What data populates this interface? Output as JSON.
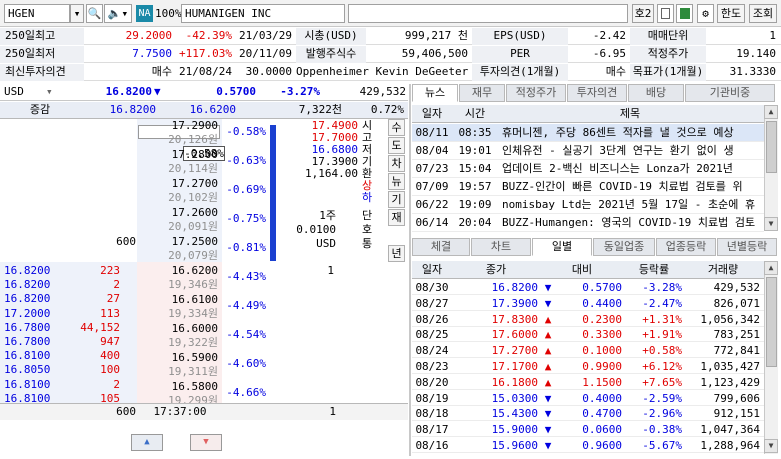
{
  "toolbar": {
    "symbol": "HGEN",
    "exchange_badge": "NA",
    "zoom": "100%",
    "company": "HUMANIGEN INC",
    "screen_no": "호2",
    "limit_label": "한도",
    "lookup_label": "조회"
  },
  "info": {
    "r1": {
      "k1": "250일최고",
      "v1": "29.2000",
      "p1": "-42.39%",
      "d1": "21/03/29",
      "k2": "시총(USD)",
      "v2": "999,217 천",
      "k3": "EPS(USD)",
      "v3": "-2.42",
      "k4": "매매단위",
      "v4": "1"
    },
    "r2": {
      "k1": "250일최저",
      "v1": "7.7500",
      "p1": "+117.03%",
      "d1": "20/11/09",
      "k2": "발행주식수",
      "v2": "59,406,500",
      "k3": "PER",
      "v3": "-6.95",
      "k4": "적정주가",
      "v4": "19.140"
    },
    "r3": {
      "k1": "최신투자의견",
      "v1": "매수",
      "d1": "21/08/24",
      "t1": "30.0000",
      "analyst": "Oppenheimer Kevin DeGeeter",
      "k3": "투자의견(1개월)",
      "v3": "매수",
      "k4": "목표가(1개월)",
      "v4": "31.3330"
    }
  },
  "quote": {
    "currency": "USD",
    "price": "16.8200",
    "change": "0.5700",
    "pct": "-3.27%",
    "volume": "429,532",
    "incr_label": "증감",
    "bid_total": "16.8200",
    "ask_total": "16.6200",
    "vol2": "7,322천",
    "ratio": "0.72%"
  },
  "orderbook": {
    "asks": [
      {
        "price": "17.2900",
        "sub": "20,126원",
        "pct": "-0.58%"
      },
      {
        "price": "17.2800",
        "sub": "20,114원",
        "pct": "-0.63%"
      },
      {
        "price": "17.2700",
        "sub": "20,102원",
        "pct": "-0.69%"
      },
      {
        "price": "17.2600",
        "sub": "20,091원",
        "pct": "-0.75%"
      },
      {
        "price": "17.2500",
        "sub": "20,079원",
        "pct": "-0.81%",
        "qty": "600"
      }
    ],
    "tooltip": "-0.58%",
    "bids": [
      {
        "price": "16.6200",
        "sub": "19,346원",
        "pct": "-4.43%",
        "qty": "1"
      },
      {
        "price": "16.6100",
        "sub": "19,334원",
        "pct": "-4.49%"
      },
      {
        "price": "16.6000",
        "sub": "19,322원",
        "pct": "-4.54%"
      },
      {
        "price": "16.5900",
        "sub": "19,311원",
        "pct": "-4.60%"
      },
      {
        "price": "16.5800",
        "sub": "19,299원",
        "pct": "-4.66%"
      }
    ],
    "ohlc": [
      {
        "v": "17.4900",
        "c": "red"
      },
      {
        "v": "17.7000",
        "c": "red"
      },
      {
        "v": "16.6800",
        "c": "blue"
      },
      {
        "v": "17.3900",
        "c": "black"
      },
      {
        "v": "1,164.00",
        "c": "black"
      }
    ],
    "ohlc_labels": [
      "시",
      "고",
      "저",
      "기",
      "환"
    ],
    "sell_label": "상",
    "buy_label": "하",
    "unit": "1주",
    "min_tick": "0.0100",
    "ccy": "USD",
    "unit_labels": [
      "단",
      "호",
      "통"
    ],
    "side_tabs": [
      "수",
      "도",
      "차",
      "뉴",
      "기",
      "재",
      "년"
    ],
    "ticks": [
      {
        "p": "16.8200",
        "q": "223"
      },
      {
        "p": "16.8200",
        "q": "2"
      },
      {
        "p": "16.8200",
        "q": "27"
      },
      {
        "p": "17.2000",
        "q": "113"
      },
      {
        "p": "16.7800",
        "q": "44,152"
      },
      {
        "p": "16.7800",
        "q": "947"
      },
      {
        "p": "16.8100",
        "q": "400"
      },
      {
        "p": "16.8050",
        "q": "100"
      },
      {
        "p": "16.8100",
        "q": "2"
      },
      {
        "p": "16.8100",
        "q": "105"
      }
    ],
    "footer": {
      "left": "600",
      "time": "17:37:00",
      "right": "1"
    }
  },
  "news": {
    "tabs": [
      "뉴스",
      "재무",
      "적정주가",
      "투자의견",
      "배당",
      "기관비중"
    ],
    "headers": [
      "일자",
      "시간",
      "제목"
    ],
    "rows": [
      {
        "d": "08/11",
        "t": "08:35",
        "title": "휴머니젠, 주당 86센트 적자를 낼 것으로 예상"
      },
      {
        "d": "08/04",
        "t": "19:01",
        "title": "인체유전 - 실공기 3단계 연구는 환기 없이 생"
      },
      {
        "d": "07/23",
        "t": "15:04",
        "title": "업데이트 2-백신 비즈니스는 Lonza가 2021년"
      },
      {
        "d": "07/09",
        "t": "19:57",
        "title": "BUZZ-인간이 빠른 COVID-19 치료법 검토를 위"
      },
      {
        "d": "06/22",
        "t": "19:09",
        "title": "nomisbay Ltd는 2021년 5월 17일 - 초순에 휴"
      },
      {
        "d": "06/14",
        "t": "20:04",
        "title": "BUZZ-Humangen: 영국의 COVID-19 치료법 검토"
      }
    ]
  },
  "daily": {
    "tabs": [
      "체결",
      "차트",
      "일별",
      "동일업종",
      "업종등락",
      "년별등락"
    ],
    "headers": [
      "일자",
      "종가",
      "대비",
      "등락률",
      "거래량"
    ],
    "rows": [
      {
        "d": "08/30",
        "c": "16.8200",
        "dir": "down",
        "chg": "0.5700",
        "pct": "-3.28%",
        "vol": "429,532"
      },
      {
        "d": "08/27",
        "c": "17.3900",
        "dir": "down",
        "chg": "0.4400",
        "pct": "-2.47%",
        "vol": "826,071"
      },
      {
        "d": "08/26",
        "c": "17.8300",
        "dir": "up",
        "chg": "0.2300",
        "pct": "+1.31%",
        "vol": "1,056,342"
      },
      {
        "d": "08/25",
        "c": "17.6000",
        "dir": "up",
        "chg": "0.3300",
        "pct": "+1.91%",
        "vol": "783,251"
      },
      {
        "d": "08/24",
        "c": "17.2700",
        "dir": "up",
        "chg": "0.1000",
        "pct": "+0.58%",
        "vol": "772,841"
      },
      {
        "d": "08/23",
        "c": "17.1700",
        "dir": "up",
        "chg": "0.9900",
        "pct": "+6.12%",
        "vol": "1,035,427"
      },
      {
        "d": "08/20",
        "c": "16.1800",
        "dir": "up",
        "chg": "1.1500",
        "pct": "+7.65%",
        "vol": "1,123,429"
      },
      {
        "d": "08/19",
        "c": "15.0300",
        "dir": "down",
        "chg": "0.4000",
        "pct": "-2.59%",
        "vol": "799,606"
      },
      {
        "d": "08/18",
        "c": "15.4300",
        "dir": "down",
        "chg": "0.4700",
        "pct": "-2.96%",
        "vol": "912,151"
      },
      {
        "d": "08/17",
        "c": "15.9000",
        "dir": "down",
        "chg": "0.0600",
        "pct": "-0.38%",
        "vol": "1,047,364"
      },
      {
        "d": "08/16",
        "c": "15.9600",
        "dir": "down",
        "chg": "0.9600",
        "pct": "-5.67%",
        "vol": "1,288,964"
      }
    ]
  },
  "colors": {
    "up": "#e00000",
    "down": "#0000e0",
    "accent": "#2050c0",
    "bg_header": "#e9edf3"
  }
}
